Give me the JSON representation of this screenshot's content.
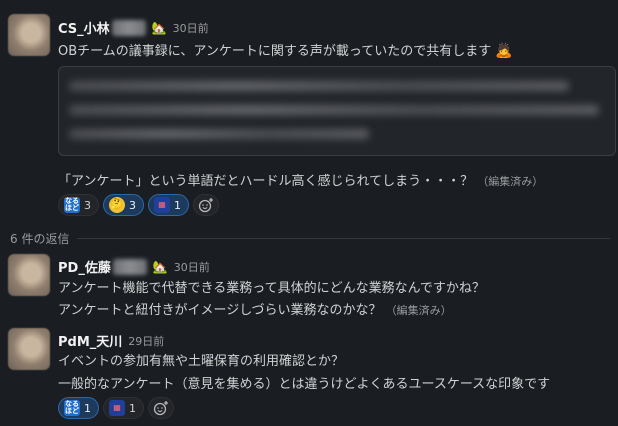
{
  "thread": {
    "parent": {
      "author": "CS_小林",
      "time": "30日前",
      "text": "OBチームの議事録に、アンケートに関する声が載っていたので共有します",
      "followup": "「アンケート」という単語だとハードル高く感じられてしまう・・・？",
      "edited": "（編集済み）",
      "reactions": [
        {
          "emoji": "naruhodo",
          "label": "なるほど",
          "count": "3"
        },
        {
          "emoji": "thinking-face",
          "label": "🤔",
          "count": "3"
        },
        {
          "emoji": "blue-custom",
          "label": "",
          "count": "1"
        }
      ]
    },
    "reply_count_label": "6 件の返信",
    "replies": [
      {
        "author": "PD_佐藤",
        "time": "30日前",
        "lines": [
          "アンケート機能で代替できる業務って具体的にどんな業務なんですかね？",
          "アンケートと紐付きがイメージしづらい業務なのかな？"
        ],
        "edited": "（編集済み）"
      },
      {
        "author": "PdM_天川",
        "time": "29日前",
        "lines": [
          "イベントの参加有無や土曜保育の利用確認とか？",
          "一般的なアンケート（意見を集める）とは違うけどよくあるユースケースな印象です"
        ],
        "reactions": [
          {
            "emoji": "naruhodo",
            "label": "なるほど",
            "count": "1"
          },
          {
            "emoji": "blue-custom",
            "label": "",
            "count": "1"
          }
        ]
      }
    ]
  },
  "colors": {
    "background": "#1a1d21",
    "text": "#d1d2d3",
    "muted": "#9a9b9d",
    "reaction_active": "#1d3a5c"
  }
}
